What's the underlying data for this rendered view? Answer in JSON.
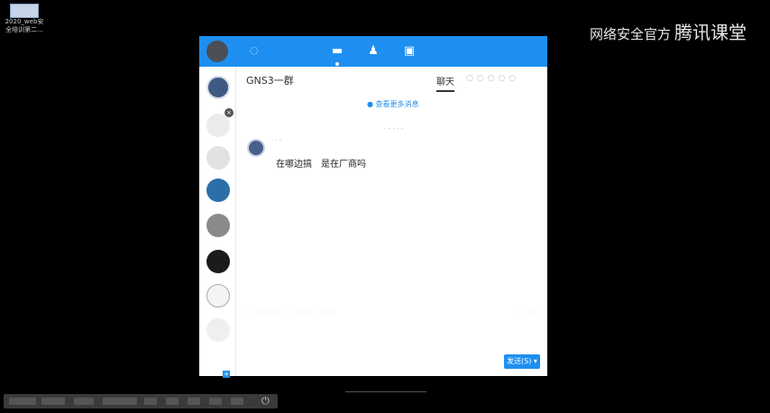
{
  "desktop": {
    "icon_label_line1": "2020_web安",
    "icon_label_line2": "全培训第二..."
  },
  "watermark": {
    "text": "网络安全官方",
    "brand": "腾讯课堂"
  },
  "qq": {
    "tabs": {
      "messages_icon": "chat-bubble-icon",
      "contacts_icon": "person-icon",
      "apps_icon": "apps-icon"
    },
    "chat": {
      "title": "GNS3一群",
      "tab_chat": "聊天",
      "history_link": "● 查看更多消息",
      "message_text": "在哪边搞　是在厂商吗"
    },
    "send_button": "发送(S) ▾"
  },
  "colors": {
    "accent": "#1e8ff0",
    "desktop_bg": "#000000"
  }
}
